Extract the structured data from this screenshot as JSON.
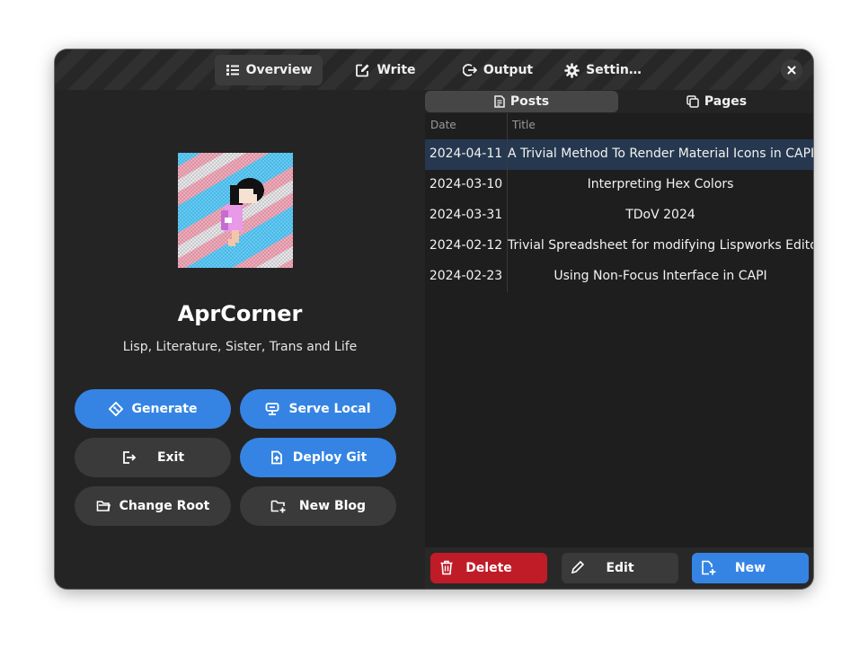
{
  "header": {
    "tabs": [
      {
        "label": "Overview",
        "icon": "list-icon"
      },
      {
        "label": "Write",
        "icon": "edit-icon"
      },
      {
        "label": "Output",
        "icon": "logout-icon"
      },
      {
        "label": "Settin…",
        "icon": "gear-icon"
      }
    ],
    "active_tab": "Overview",
    "close_icon": "close-icon"
  },
  "profile": {
    "title": "AprCorner",
    "subtitle": "Lisp, Literature, Sister, Trans and Life"
  },
  "actions": {
    "generate": "Generate",
    "serve_local": "Serve Local",
    "exit": "Exit",
    "deploy_git": "Deploy Git",
    "change_root": "Change Root",
    "new_blog": "New Blog"
  },
  "content_switcher": {
    "posts": "Posts",
    "pages": "Pages",
    "active": "Posts"
  },
  "table": {
    "columns": [
      "Date",
      "Title"
    ],
    "rows": [
      {
        "date": "2024-04-11",
        "title": "A Trivial Method To Render Material Icons in CAPI",
        "selected": true
      },
      {
        "date": "2024-03-10",
        "title": "Interpreting Hex Colors",
        "selected": false
      },
      {
        "date": "2024-03-31",
        "title": "TDoV 2024",
        "selected": false
      },
      {
        "date": "2024-02-12",
        "title": "Trivial Spreadsheet for modifying Lispworks Editor",
        "selected": false
      },
      {
        "date": "2024-02-23",
        "title": "Using Non-Focus Interface in CAPI",
        "selected": false
      }
    ]
  },
  "footer": {
    "delete": "Delete",
    "edit": "Edit",
    "new": "New"
  },
  "colors": {
    "accent": "#3584e4",
    "destructive": "#c01c28",
    "window_bg": "#242424",
    "selected_row": "#26384f"
  }
}
